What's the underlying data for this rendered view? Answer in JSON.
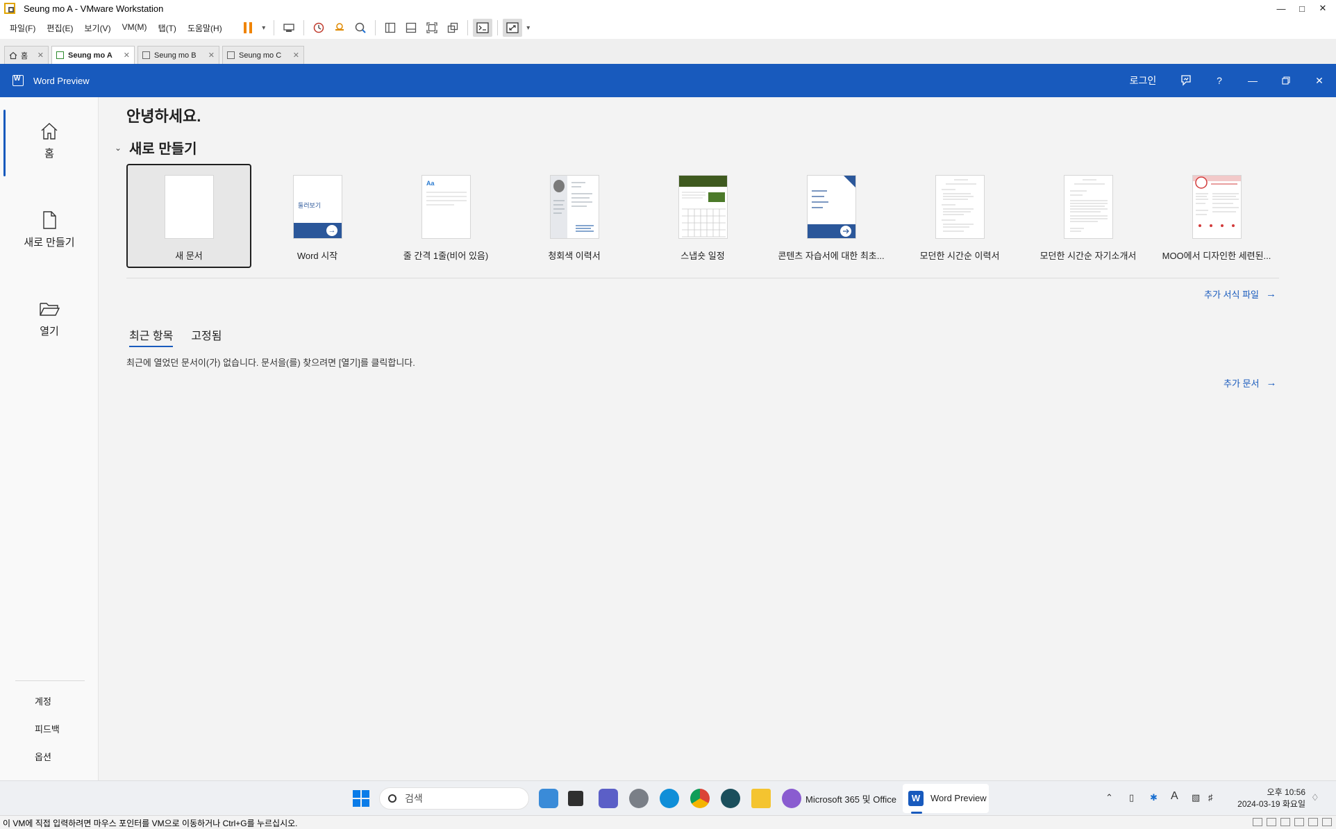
{
  "vm": {
    "title": "Seung mo A - VMware Workstation",
    "menus": [
      "파일(F)",
      "편집(E)",
      "보기(V)",
      "VM(M)",
      "탭(T)",
      "도움말(H)"
    ],
    "tabs": [
      {
        "label": "홈"
      },
      {
        "label": "Seung mo A"
      },
      {
        "label": "Seung mo B"
      },
      {
        "label": "Seung mo C"
      }
    ],
    "status_message": "이 VM에 직접 입력하려면 마우스 포인터를 VM으로 이동하거나 Ctrl+G를 누르십시오."
  },
  "word": {
    "app_title": "Word Preview",
    "signin": "로그인",
    "help": "?",
    "sidebar": {
      "home": "홈",
      "new": "새로 만들기",
      "open": "열기",
      "account": "계정",
      "feedback": "피드백",
      "options": "옵션"
    },
    "greeting": "안녕하세요.",
    "new_section_title": "새로 만들기",
    "templates": [
      {
        "label": "새 문서"
      },
      {
        "label": "Word 시작",
        "thumb_text": "둘러보기"
      },
      {
        "label": "줄 간격 1줄(비어 있음)",
        "thumb_text": "Aa"
      },
      {
        "label": "청회색 이력서"
      },
      {
        "label": "스냅숏 일정"
      },
      {
        "label": "콘텐츠 자습서에 대한 최초..."
      },
      {
        "label": "모던한 시간순 이력서"
      },
      {
        "label": "모던한 시간순 자기소개서"
      },
      {
        "label": "MOO에서 디자인한 세련된..."
      }
    ],
    "more_templates": "추가 서식 파일",
    "recent_tabs": [
      "최근 항목",
      "고정됨"
    ],
    "empty_message": "최근에 열었던 문서이(가) 없습니다. 문서을(를) 찾으려면 [열기]를 클릭합니다.",
    "more_documents": "추가 문서"
  },
  "taskbar": {
    "search_placeholder": "검색",
    "ms365_label": "Microsoft 365 및 Office",
    "word_label": "Word Preview",
    "time": "오후 10:56",
    "date": "2024-03-19 화요일"
  },
  "colors": {
    "word_blue": "#185abd",
    "vm_pause": "#f08400"
  }
}
